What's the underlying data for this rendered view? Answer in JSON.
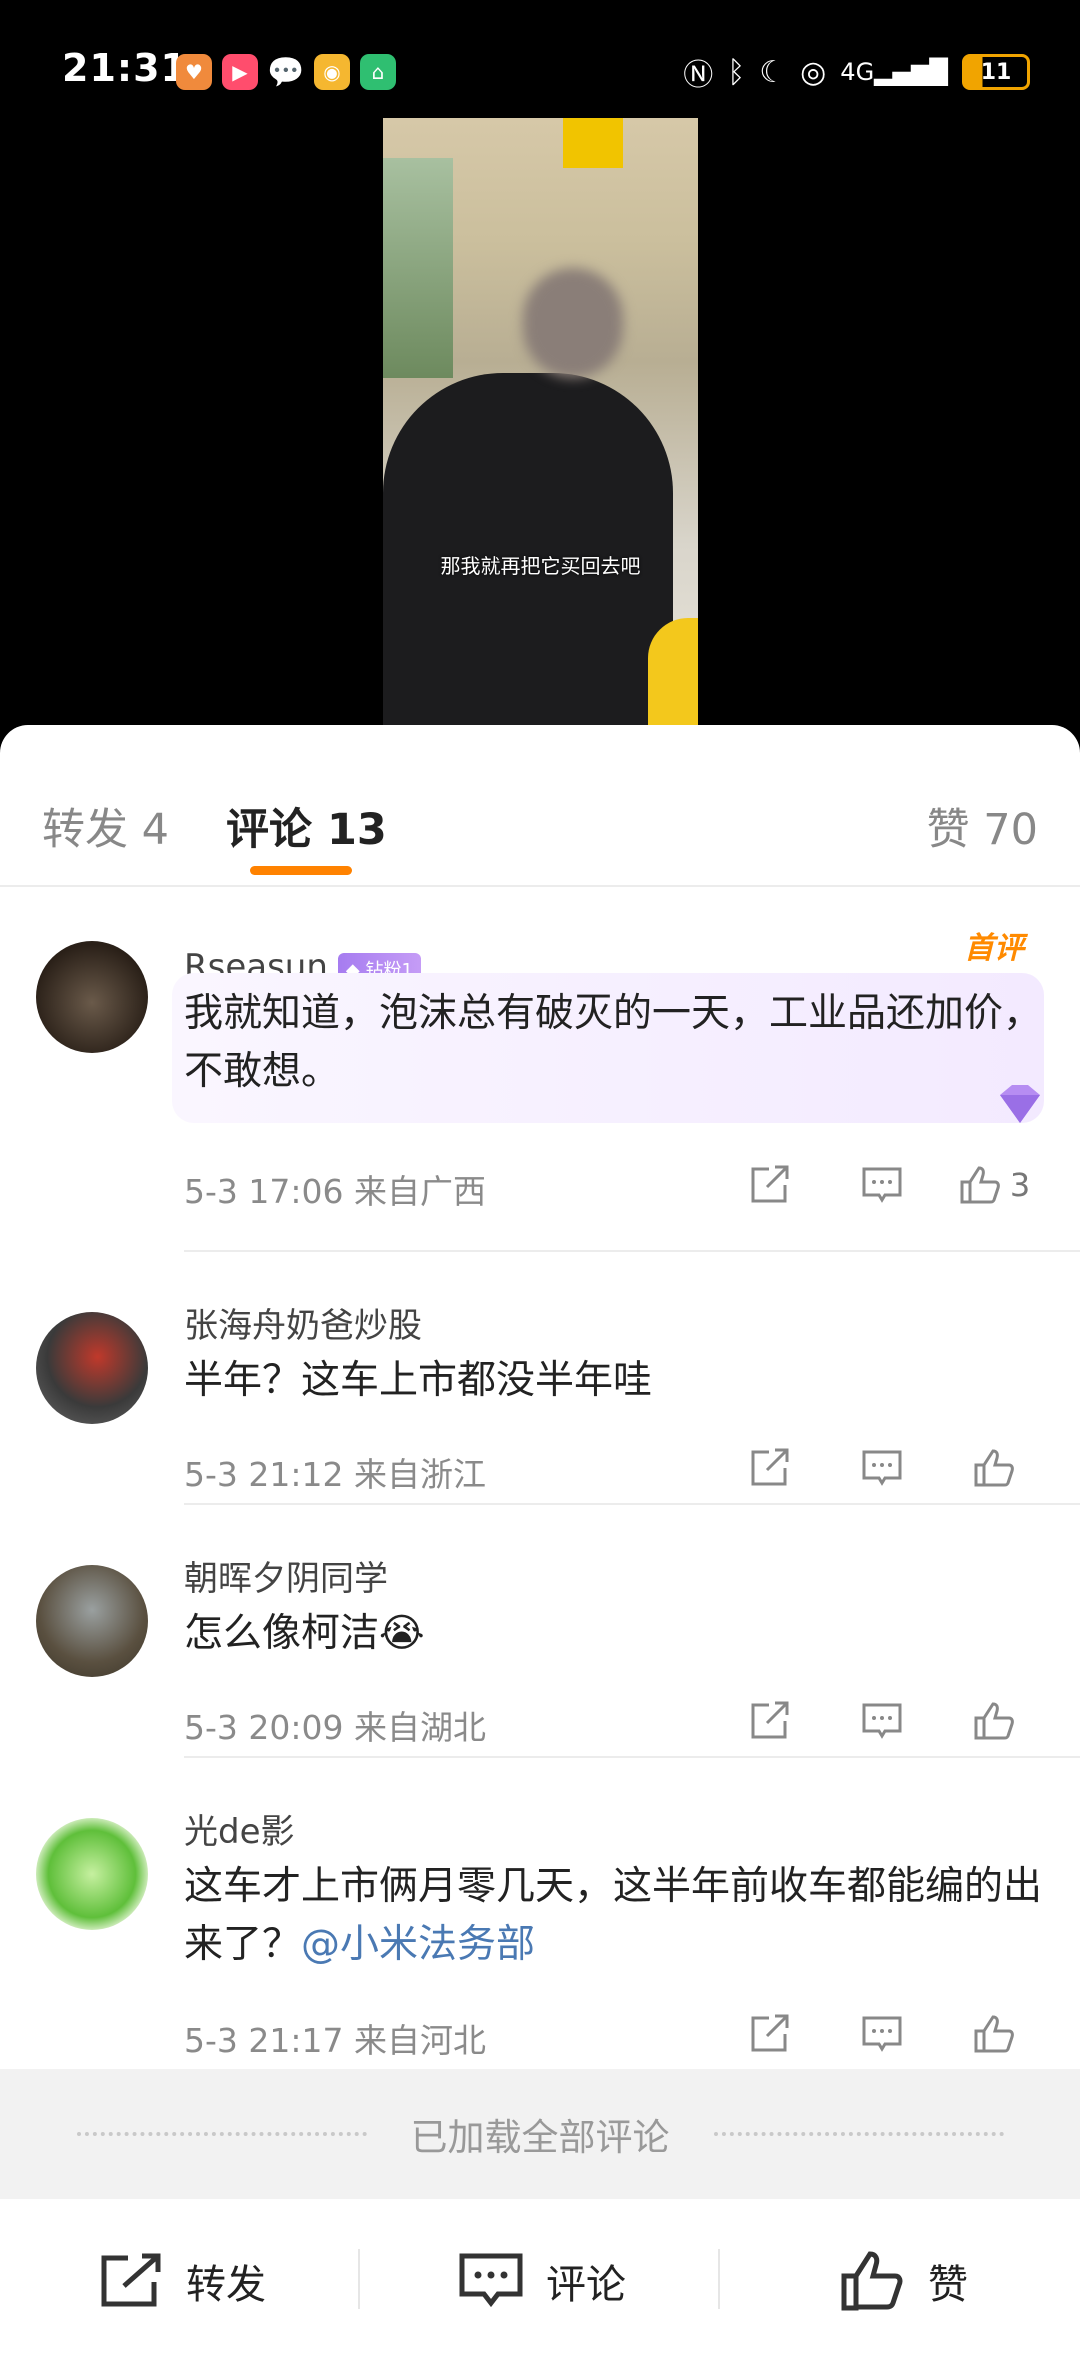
{
  "status_bar": {
    "time": "21:31"
  },
  "video": {
    "subtitle": "那我就再把它买回去吧"
  },
  "tabs": {
    "repost": "转发 4",
    "comments": "评论 13",
    "likes": "赞 70"
  },
  "comments": [
    {
      "name": "Rseasun",
      "badge": "钻粉1",
      "tag": "首评",
      "text": "我就知道，泡沫总有破灭的一天，工业品还加价，不敢想。",
      "meta": "5-3 17:06  来自广西",
      "likes": "3"
    },
    {
      "name": "张海舟奶爸炒股",
      "text": "半年？这车上市都没半年哇",
      "meta": "5-3 21:12  来自浙江",
      "likes": ""
    },
    {
      "name": "朝晖夕阴同学",
      "text": "怎么像柯洁😭",
      "meta": "5-3 20:09  来自湖北",
      "likes": ""
    },
    {
      "name": "光de影",
      "text": "这车才上市俩月零几天，这半年前收车都能编的出来了？",
      "mention": "@小米法务部",
      "meta": "5-3 21:17  来自河北",
      "likes": ""
    }
  ],
  "footer": {
    "loaded": "已加载全部评论"
  },
  "bottom_bar": {
    "repost": "转发",
    "comment": "评论",
    "like": "赞"
  },
  "colors": {
    "accent": "#ff8200",
    "mention": "#4a79b3",
    "badge": "#a67cf0"
  }
}
